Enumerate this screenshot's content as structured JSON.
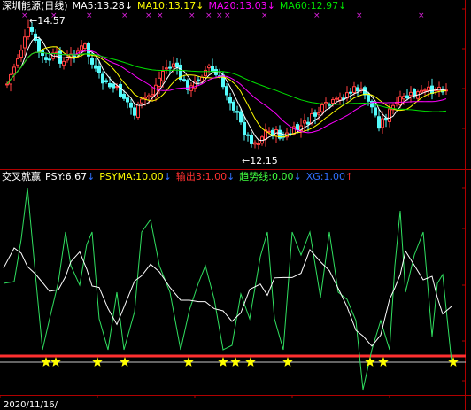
{
  "price_panel": {
    "labels": {
      "stock": "深圳能源(日线)",
      "ma5": "MA5:13.28",
      "ma10": "MA10:13.17",
      "ma20": "MA20:13.03",
      "ma60": "MA60:12.97"
    },
    "arrows": {
      "ma5": "↓",
      "ma10": "↓",
      "ma20": "↓",
      "ma60": "↓"
    },
    "high_label": "14.57",
    "low_label": "12.15",
    "marker_symbol": "×",
    "marker_count": 14
  },
  "indicator_panel": {
    "labels": {
      "name": "交叉就赢",
      "psy": "PSY:6.67",
      "psyma": "PSYMA:10.00",
      "output": "输出3:1.00",
      "trend": "趋势线:0.00",
      "xg": "XG:1.00"
    },
    "arrows": {
      "psy": "↓",
      "psyma": "↓",
      "output": "↓",
      "trend": "↓",
      "xg": "↑"
    },
    "star_count": 13
  },
  "axis": {
    "date_label": "2020/11/16/"
  },
  "colors": {
    "background": "#000000",
    "up_candle": "#ff4040",
    "down_candle": "#54fcfc",
    "ma5": "#ffffff",
    "ma10": "#ffff00",
    "ma20": "#ff00ff",
    "ma60": "#00e000",
    "psy": "#30e060",
    "psyma": "#ffffff",
    "output": "#ff3030",
    "trend": "#40ff40",
    "xg": "#3070ff",
    "star": "#ffff00",
    "frame": "#b00000"
  }
}
